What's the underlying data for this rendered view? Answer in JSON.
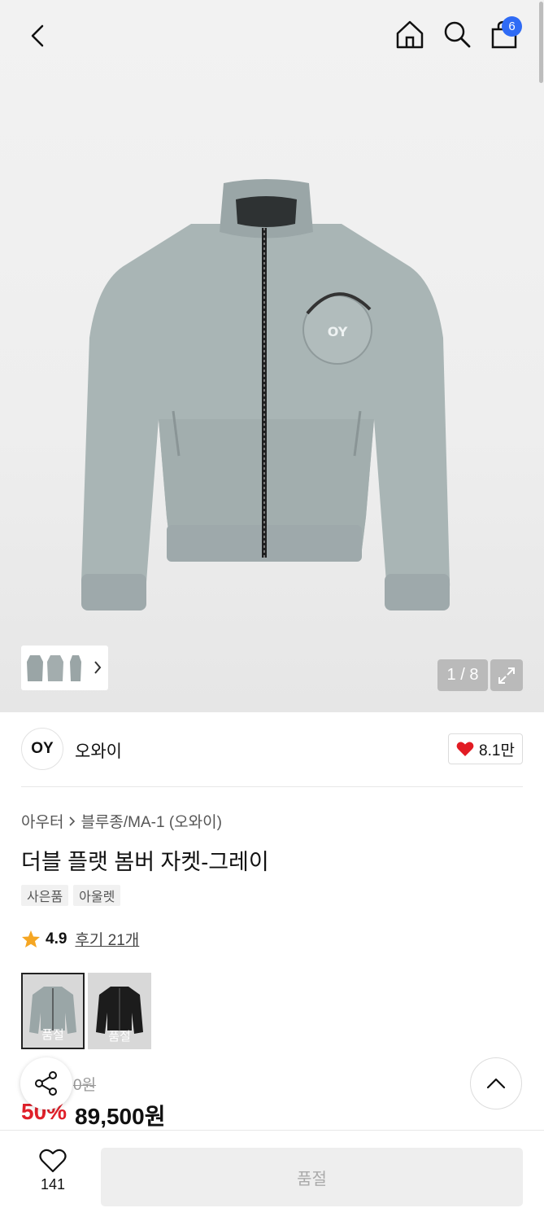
{
  "header": {
    "cart_count": "6",
    "icons": [
      "back-icon",
      "home-icon",
      "search-icon",
      "cart-icon"
    ]
  },
  "gallery": {
    "counter": "1 / 8",
    "jacket_logo": "OY"
  },
  "brand": {
    "logo": "OY",
    "name": "오와이",
    "likes": "8.1만"
  },
  "breadcrumb": {
    "category": "아우터",
    "subcategory": "블루종/MA-1 (오와이)"
  },
  "product": {
    "title": "더블 플랫 봄버 자켓-그레이",
    "tags": [
      "사은품",
      "아울렛"
    ],
    "rating": "4.9",
    "review_label": "후기 21개",
    "colors": [
      {
        "name": "gray",
        "status": "품절",
        "selected": true
      },
      {
        "name": "black",
        "status": "품절",
        "selected": false
      }
    ],
    "original_price": "0원",
    "discount": "50%",
    "price": "89,500원"
  },
  "bottom": {
    "wish_count": "141",
    "buy_label": "품절"
  },
  "colors": {
    "accent_red": "#e0202a",
    "badge_blue": "#2f6bf5",
    "jacket_gray": "#a9b5b5"
  }
}
